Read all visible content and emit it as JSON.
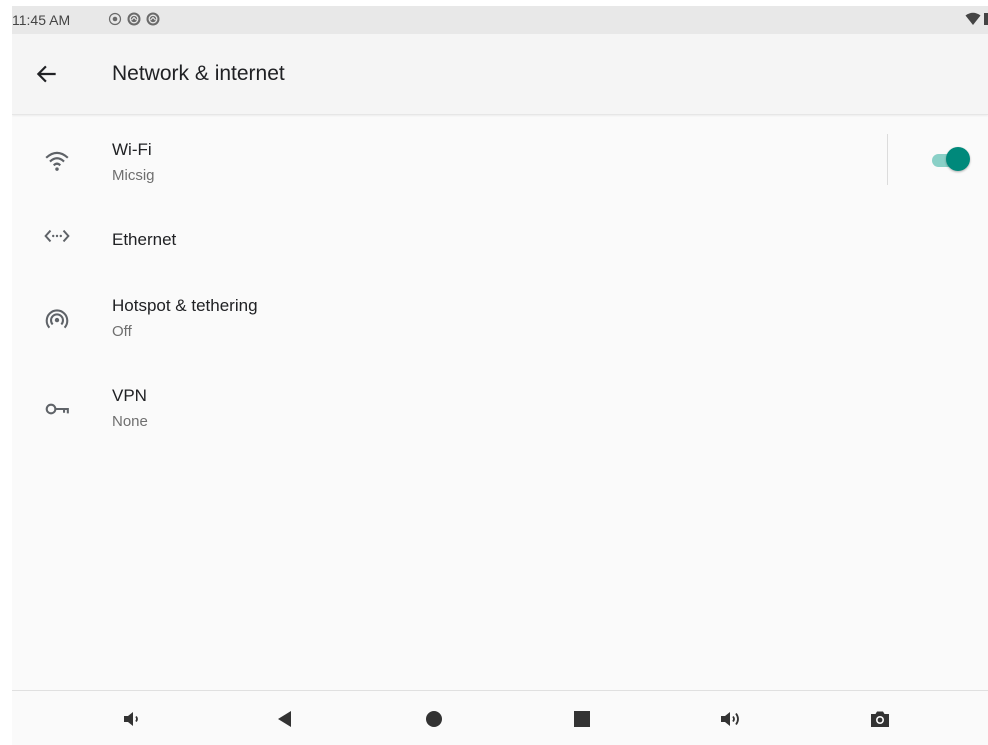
{
  "status_bar": {
    "time": "11:45 AM",
    "icons": [
      "record-icon",
      "app-notification-icon",
      "app-notification-icon"
    ],
    "right_icons": [
      "wifi-signal-icon",
      "battery-icon"
    ]
  },
  "app_bar": {
    "back_icon": "arrow-back-icon",
    "title": "Network & internet"
  },
  "items": [
    {
      "icon": "wifi-icon",
      "title": "Wi-Fi",
      "subtitle": "Micsig",
      "toggle_on": true
    },
    {
      "icon": "ethernet-icon",
      "title": "Ethernet",
      "subtitle": ""
    },
    {
      "icon": "hotspot-icon",
      "title": "Hotspot & tethering",
      "subtitle": "Off"
    },
    {
      "icon": "vpn-key-icon",
      "title": "VPN",
      "subtitle": "None"
    }
  ],
  "nav_bar": {
    "buttons": [
      "volume-down-icon",
      "back-triangle-icon",
      "home-circle-icon",
      "recents-square-icon",
      "volume-up-icon",
      "screenshot-camera-icon"
    ]
  },
  "colors": {
    "accent": "#00897b",
    "accent_track": "#8ad0c7",
    "background": "#fafafa",
    "icon_gray": "#5f6368",
    "subtitle_gray": "#6f6f6f"
  }
}
